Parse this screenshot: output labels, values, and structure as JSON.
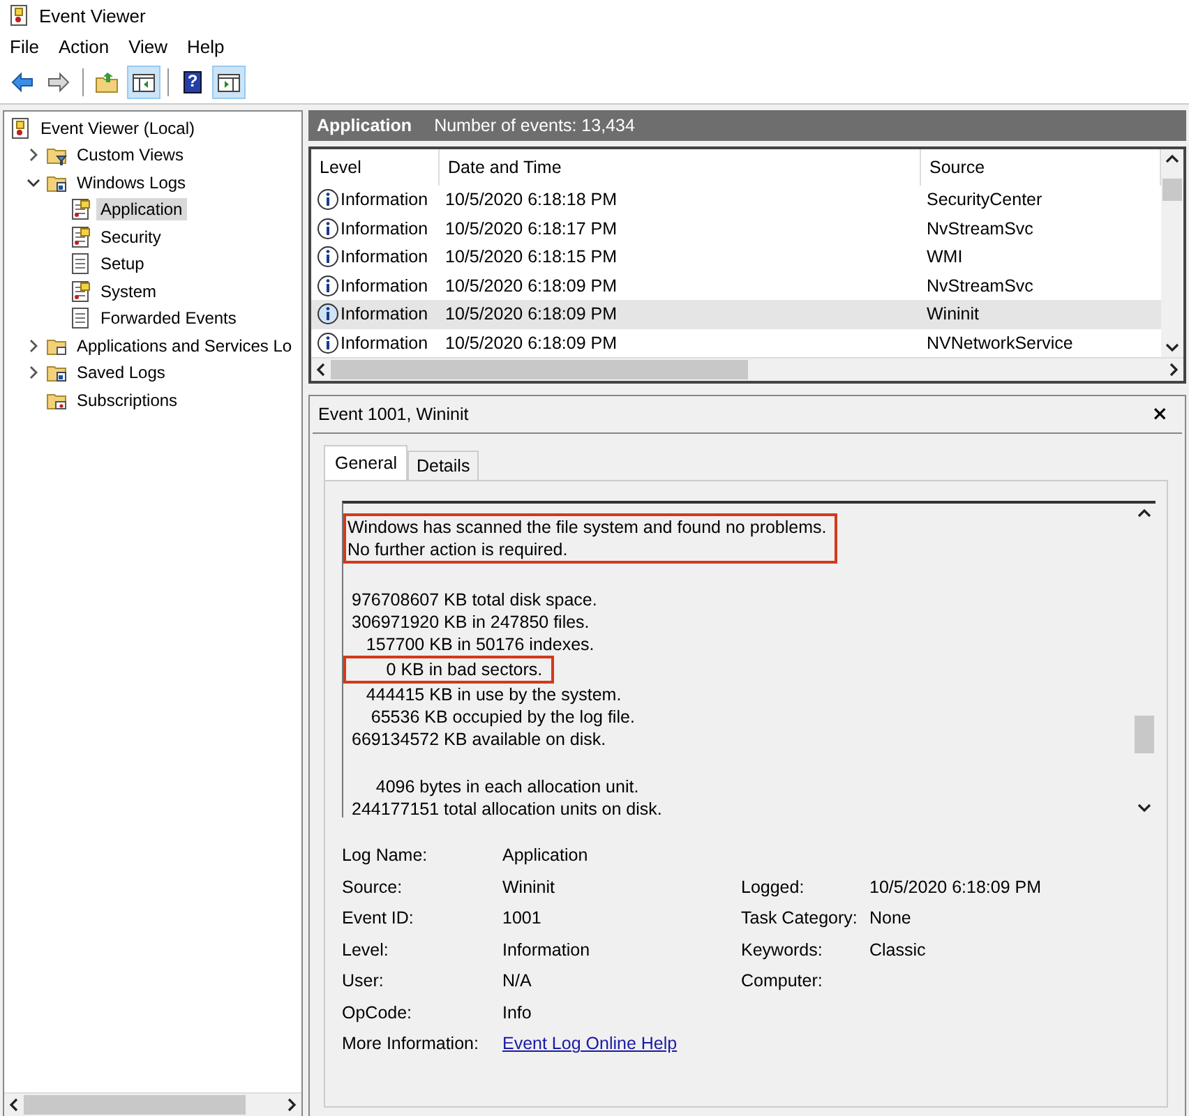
{
  "window": {
    "title": "Event Viewer"
  },
  "menu": [
    "File",
    "Action",
    "View",
    "Help"
  ],
  "toolbar": [
    {
      "kind": "back",
      "pressed": false
    },
    {
      "kind": "forward",
      "pressed": false
    },
    {
      "kind": "sep"
    },
    {
      "kind": "folder-up",
      "pressed": false
    },
    {
      "kind": "console-tree",
      "pressed": true
    },
    {
      "kind": "sep"
    },
    {
      "kind": "help",
      "glyph": "?",
      "pressed": false
    },
    {
      "kind": "action-pane",
      "pressed": true
    }
  ],
  "tree": [
    {
      "label": "Event Viewer (Local)",
      "kind": "root",
      "selected": false,
      "children": [
        {
          "label": "Custom Views",
          "kind": "filter-folder",
          "expanded": false,
          "selected": false
        },
        {
          "label": "Windows Logs",
          "kind": "logs-folder",
          "expanded": true,
          "selected": false,
          "children": [
            {
              "label": "Application",
              "kind": "log",
              "selected": true
            },
            {
              "label": "Security",
              "kind": "log",
              "selected": false
            },
            {
              "label": "Setup",
              "kind": "plain-log",
              "selected": false
            },
            {
              "label": "System",
              "kind": "log",
              "selected": false
            },
            {
              "label": "Forwarded Events",
              "kind": "plain-log",
              "selected": false
            }
          ]
        },
        {
          "label": "Applications and Services Lo",
          "kind": "folder",
          "expanded": false,
          "selected": false
        },
        {
          "label": "Saved Logs",
          "kind": "logs-folder",
          "expanded": false,
          "selected": false
        },
        {
          "label": "Subscriptions",
          "kind": "subscriptions",
          "selected": false
        }
      ]
    }
  ],
  "log_header": {
    "title": "Application",
    "count": "Number of events: 13,434"
  },
  "events": {
    "columns": [
      "Level",
      "Date and Time",
      "Source"
    ],
    "rows": [
      {
        "level": "Information",
        "time": "10/5/2020 6:18:18 PM",
        "source": "SecurityCenter",
        "selected": false
      },
      {
        "level": "Information",
        "time": "10/5/2020 6:18:17 PM",
        "source": "NvStreamSvc",
        "selected": false
      },
      {
        "level": "Information",
        "time": "10/5/2020 6:18:15 PM",
        "source": "WMI",
        "selected": false
      },
      {
        "level": "Information",
        "time": "10/5/2020 6:18:09 PM",
        "source": "NvStreamSvc",
        "selected": false
      },
      {
        "level": "Information",
        "time": "10/5/2020 6:18:09 PM",
        "source": "Wininit",
        "selected": true
      },
      {
        "level": "Information",
        "time": "10/5/2020 6:18:09 PM",
        "source": "NVNetworkService",
        "selected": false
      }
    ]
  },
  "detail": {
    "title": "Event 1001, Wininit",
    "close": "×",
    "tabs": [
      {
        "label": "General",
        "selected": true
      },
      {
        "label": "Details",
        "selected": false
      }
    ],
    "message": [
      {
        "lines": [
          {
            "text": "Windows has scanned the file system and found no problems.",
            "highlighted": true
          },
          {
            "text": "No further action is required.",
            "highlighted": true
          }
        ]
      },
      {
        "lines": [
          {
            "text": "976708607 KB total disk space.",
            "highlighted": false
          },
          {
            "text": "306971920 KB in 247850 files.",
            "highlighted": false
          },
          {
            "text": "   157700 KB in 50176 indexes.",
            "highlighted": false
          },
          {
            "text": "        0 KB in bad sectors.",
            "highlighted": true
          },
          {
            "text": "   444415 KB in use by the system.",
            "highlighted": false
          },
          {
            "text": "    65536 KB occupied by the log file.",
            "highlighted": false
          },
          {
            "text": "669134572 KB available on disk.",
            "highlighted": false
          }
        ]
      },
      {
        "lines": [
          {
            "text": "     4096 bytes in each allocation unit.",
            "highlighted": false
          },
          {
            "text": "244177151 total allocation units on disk.",
            "highlighted": false
          }
        ]
      }
    ],
    "fields": [
      {
        "label": "Log Name:",
        "value": "Application"
      },
      {
        "label": "Source:",
        "value": "Wininit",
        "label_2": "Logged:",
        "value_2": "10/5/2020 6:18:09 PM"
      },
      {
        "label": "Event ID:",
        "value": "1001",
        "label_2": "Task Category:",
        "value_2": "None"
      },
      {
        "label": "Level:",
        "value": "Information",
        "label_2": "Keywords:",
        "value_2": "Classic"
      },
      {
        "label": "User:",
        "value": "N/A",
        "label_2": "Computer:"
      },
      {
        "label": "OpCode:",
        "value": "Info"
      },
      {
        "label": "More Information:",
        "value": "Event Log Online Help",
        "kind": "link"
      }
    ]
  }
}
